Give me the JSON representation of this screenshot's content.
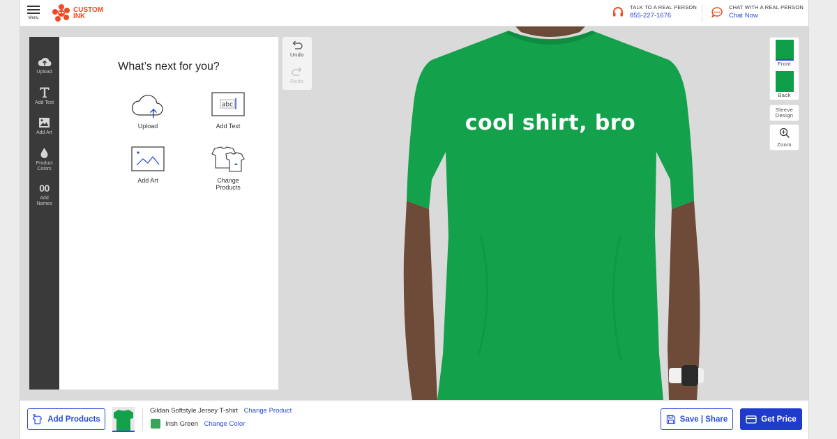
{
  "header": {
    "menu_label": "Menu",
    "logo_line1": "CUSTOM",
    "logo_line2": "INK",
    "phone": {
      "label": "TALK TO A REAL PERSON",
      "value": "855-227-1676"
    },
    "chat": {
      "label": "CHAT WITH A REAL PERSON",
      "value": "Chat Now"
    }
  },
  "rail": {
    "items": [
      {
        "label": "Upload",
        "icon": "cloud-upload-icon"
      },
      {
        "label": "Add Text",
        "icon": "text-t-icon"
      },
      {
        "label": "Add Art",
        "icon": "image-icon"
      },
      {
        "label_line1": "Product",
        "label_line2": "Colors",
        "icon": "droplet-icon"
      },
      {
        "label_line1": "Add",
        "label_line2": "Names",
        "icon": "jersey-number-icon",
        "icon_text": "00"
      }
    ]
  },
  "panel": {
    "title": "What’s next for you?",
    "options": [
      {
        "label": "Upload",
        "icon": "cloud-upload-icon"
      },
      {
        "label": "Add Text",
        "icon": "text-box-icon",
        "icon_text": "abc"
      },
      {
        "label": "Add Art",
        "icon": "art-image-icon"
      },
      {
        "label_line1": "Change",
        "label_line2": "Products",
        "icon": "shirts-icon"
      }
    ]
  },
  "history": {
    "undo": "Undo",
    "redo": "Redo"
  },
  "design": {
    "text": "cool shirt, bro",
    "shirt_color": "#13a14b"
  },
  "views": {
    "front": "Front",
    "back": "Back",
    "sleeve_line1": "Sleeve",
    "sleeve_line2": "Design",
    "zoom": "Zoom"
  },
  "footer": {
    "add_products": "Add Products",
    "product_name": "Gildan Softstyle Jersey T-shirt",
    "change_product": "Change Product",
    "color_name": "Irish Green",
    "change_color": "Change Color",
    "save_share": "Save | Share",
    "get_price": "Get Price"
  },
  "colors": {
    "accent": "#2a4ad8",
    "brand": "#f04b24",
    "primary_button": "#1e3bcc",
    "swatch": "#3aa55a"
  }
}
